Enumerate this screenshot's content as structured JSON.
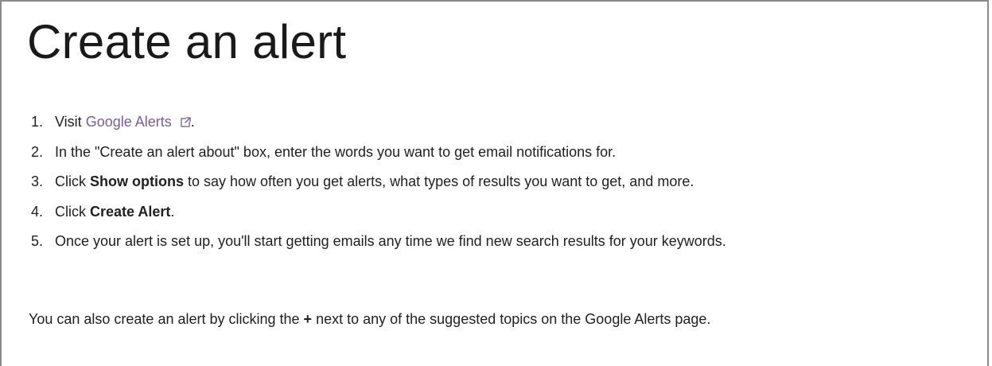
{
  "title": "Create an alert",
  "steps": [
    {
      "num": "1.",
      "prefix": "Visit ",
      "link": "Google Alerts",
      "link_icon": "external-link-icon",
      "suffix": "."
    },
    {
      "num": "2.",
      "text": "In the \"Create an alert about\" box, enter the words you want to get email notifications for."
    },
    {
      "num": "3.",
      "prefix": "Click ",
      "bold": "Show options",
      "suffix": " to say how often you get alerts, what types of results you want to get, and more."
    },
    {
      "num": "4.",
      "prefix": "Click ",
      "bold": "Create Alert",
      "suffix": "."
    },
    {
      "num": "5.",
      "text": "Once your alert is set up, you'll start getting emails any time we find new search results for your keywords."
    }
  ],
  "footer": {
    "prefix": "You can also create an alert by clicking the ",
    "bold": "+",
    "suffix": " next to any of the suggested topics on the Google Alerts page."
  },
  "colors": {
    "link": "#7b5ba8",
    "text": "#212121",
    "border": "#8a8a8a"
  }
}
